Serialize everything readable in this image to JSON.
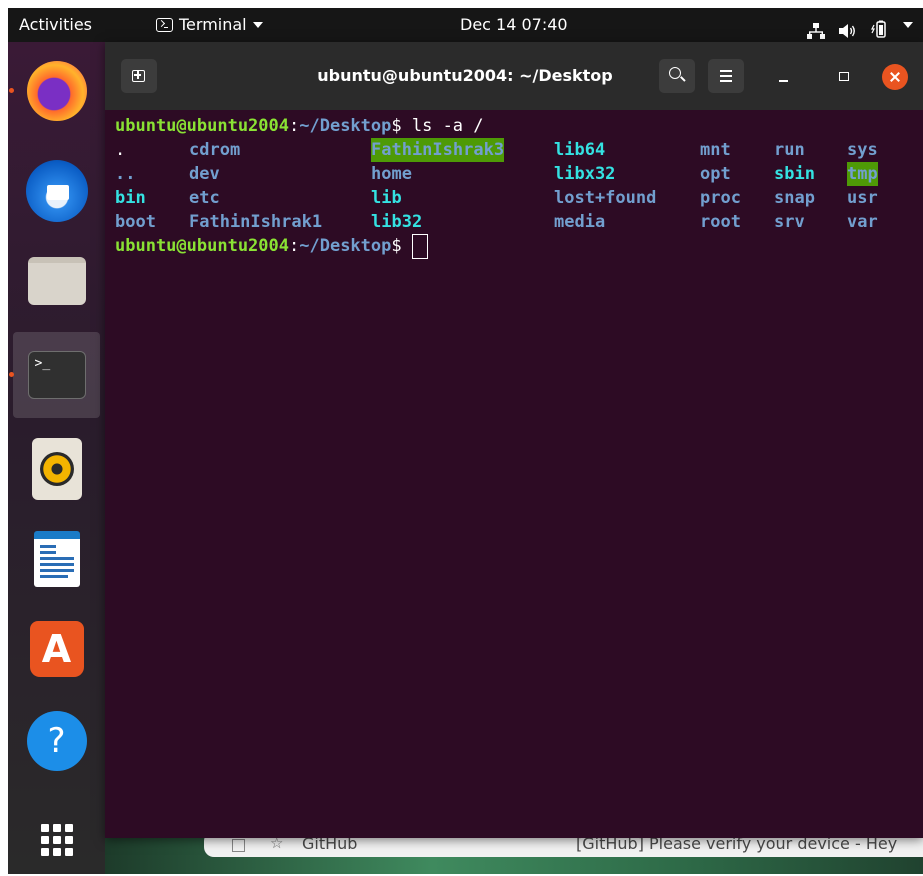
{
  "topbar": {
    "activities": "Activities",
    "app_name": "Terminal",
    "clock": "Dec 14 07:40",
    "tray_icons": [
      "network-icon",
      "volume-icon",
      "battery-icon",
      "system-menu-caret-icon"
    ]
  },
  "dock": {
    "items": [
      "Firefox",
      "Thunderbird Mail",
      "Files",
      "Terminal",
      "Rhythmbox",
      "LibreOffice Writer",
      "Ubuntu Software",
      "Help"
    ],
    "active_item": "Terminal",
    "show_apps": "show-applications-icon"
  },
  "background_window": {
    "sender": "GitHub",
    "subject": "[GitHub] Please verify your device - Hey"
  },
  "terminal": {
    "title": "ubuntu@ubuntu2004: ~/Desktop",
    "prompt": {
      "user_host": "ubuntu@ubuntu2004",
      "colon": ":",
      "path": "~/Desktop",
      "dollar": "$ "
    },
    "command": "ls -a /",
    "listing": [
      [
        ".",
        "cdrom",
        "FathinIshrak3",
        "lib64",
        "mnt",
        "run",
        "sys"
      ],
      [
        "..",
        "dev",
        "home",
        "libx32",
        "opt",
        "sbin",
        "tmp"
      ],
      [
        "bin",
        "etc",
        "lib",
        "lost+found",
        "proc",
        "snap",
        "usr"
      ],
      [
        "boot",
        "FathinIshrak1",
        "lib32",
        "media",
        "root",
        "srv",
        "var"
      ]
    ]
  },
  "colors": {
    "terminal_bg": "#2d0b24",
    "prompt_user": "#8ae234",
    "prompt_path": "#729fcf",
    "directory": "#729fcf",
    "symlink": "#34e2e2",
    "sticky_dir_bg": "#4e9a06",
    "close_button": "#e95420"
  }
}
